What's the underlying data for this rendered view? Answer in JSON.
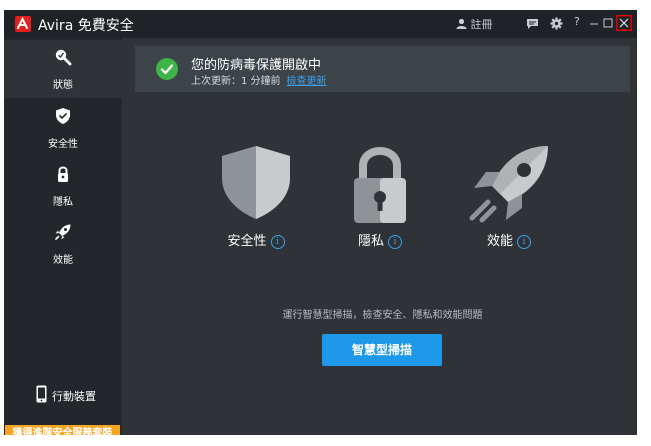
{
  "app": {
    "title": "Avira 免費安全"
  },
  "titlebar": {
    "register_label": "註冊",
    "icons": [
      "user-icon",
      "feedback-icon",
      "gear-icon",
      "help-icon",
      "minimize-icon",
      "maximize-icon",
      "close-icon"
    ],
    "help_label": "?",
    "close_highlight_color": "#e00000"
  },
  "sidebar": {
    "items": [
      {
        "label": "狀態",
        "icon": "status-icon",
        "active": true
      },
      {
        "label": "安全性",
        "icon": "shield-icon"
      },
      {
        "label": "隱私",
        "icon": "lock-icon"
      },
      {
        "label": "效能",
        "icon": "rocket-icon"
      }
    ],
    "device_label": "行動裝置",
    "upgrade_label": "獲得進階安全服務套裝"
  },
  "status": {
    "title": "您的防病毒保護開啟中",
    "subtitle": "上次更新：1 分鐘前",
    "link": "檢查更新"
  },
  "features": [
    {
      "label": "安全性",
      "icon": "shield-icon"
    },
    {
      "label": "隱私",
      "icon": "lock-icon"
    },
    {
      "label": "效能",
      "icon": "rocket-icon"
    }
  ],
  "scan": {
    "description": "運行智慧型掃描，檢查安全、隱私和效能問題",
    "button": "智慧型掃描"
  },
  "colors": {
    "accent": "#1e98e8",
    "brand": "#e1211e",
    "upgrade": "#f5a623",
    "success": "#3fb549"
  }
}
